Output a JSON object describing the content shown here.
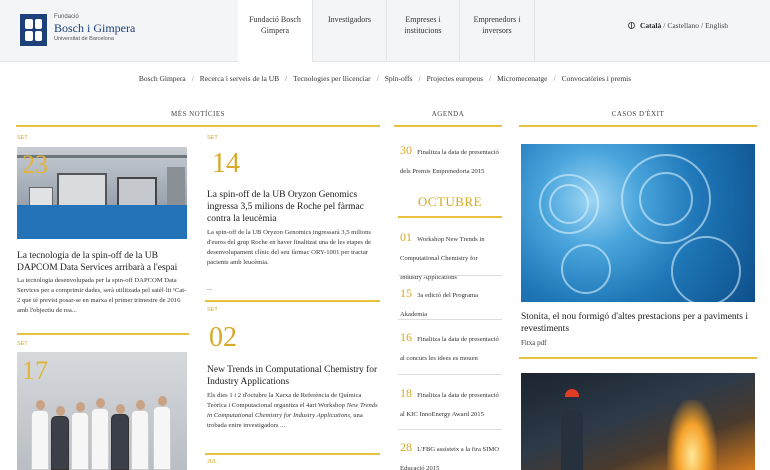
{
  "logo": {
    "small": "Fundació",
    "name": "Bosch i Gimpera",
    "sub": "Universitat de Barcelona"
  },
  "nav": [
    {
      "label": "Fundació Bosch Gimpera"
    },
    {
      "label": "Investigadors"
    },
    {
      "label": "Empreses i institucions"
    },
    {
      "label": "Emprenedors i inversors"
    }
  ],
  "lang": {
    "catala": "Català",
    "castellano": "Castellano",
    "english": "English",
    "separator": "/"
  },
  "subnav": [
    "Bosch Gimpera",
    "Recerca i serveis de la UB",
    "Tecnologies per llicenciar",
    "Spin-offs",
    "Projectes europeus",
    "Micromecenatge",
    "Convocatòries i premis"
  ],
  "sections": {
    "news": "MÉS NOTÍCIES",
    "agenda": "AGENDA",
    "cases": "CASOS D'ÈXIT"
  },
  "news_left": [
    {
      "month": "SET",
      "day": "23",
      "headline": "La tecnologia de la spin-off de la UB DAPCOM Data Services arribarà a l'espai",
      "body": "La tecnologia desenvolupada per la spin-off DAPCOM Data Services per a comprimir dades, serà utilitzada pel satèl·lit ¹Cat-2 que té previst posar-se en marxa el primer trimestre de 2016 amb l'objectiu de rea..."
    },
    {
      "month": "SET",
      "day": "17"
    }
  ],
  "news_mid": [
    {
      "month": "SET",
      "day": "14",
      "headline": "La spin-off de la UB Oryzon Genomics ingressa 3,5 milions de Roche pel fàrmac contra la leucèmia",
      "body": "La spin-off de la UB Oryzon Genomics ingressarà 3,5 milions d'euros del grup Roche en haver finalitzat una de les etapes de desenvolupament clínic del seu fàrmac ORY-1001 per tractar pacients amb leucèmia.",
      "more": "..."
    },
    {
      "month": "SET",
      "day": "02",
      "headline": "New Trends in Computational Chemistry for Industry Applications",
      "body1": "Els dies 1 i 2 d'octubre la Xarxa de Referència de Química Teòrica i Computacional organitza el 4art Workshop ",
      "body_italic": "New Trends in Computational Chemistry for Industry Applications",
      "body2": ", una trobada entre investigadors ..."
    },
    {
      "month": "JUL"
    }
  ],
  "agenda": {
    "first": {
      "day": "30",
      "text": "Finalitza la data de presentació dels Premis Emprenedoria 2015"
    },
    "month": "OCTUBRE",
    "items": [
      {
        "day": "01",
        "text": "Workshop New Trends in Computational Chemistry for Industry Applications"
      },
      {
        "day": "15",
        "text": "3a edició del Programa Akademia"
      },
      {
        "day": "16",
        "text": "Finalitza la data de presentació al concurs les idees es mouen"
      },
      {
        "day": "18",
        "text": "Finalitza la data de presentació al KIC InnoEnergy Award 2015"
      },
      {
        "day": "28",
        "text": "L'FBG assisteix a la fira SIMO Educació 2015"
      }
    ]
  },
  "cases": [
    {
      "headline": "Stonita, el nou formigó d'altes prestacions per a paviments i revestiments",
      "link": "Fitxa pdf"
    }
  ],
  "colors": {
    "accent": "#e8c13f",
    "accent_text": "#d4a822",
    "brand": "#1d3f7a",
    "header_bg": "#f4f5f6"
  }
}
